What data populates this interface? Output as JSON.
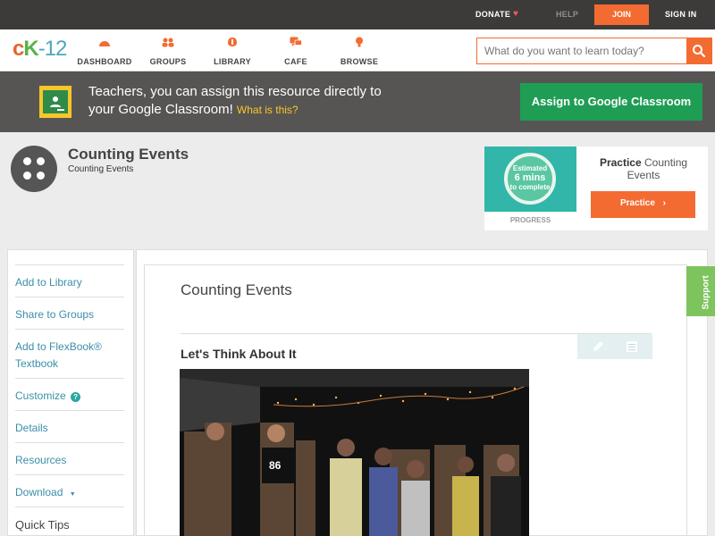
{
  "topbar": {
    "donate": "DONATE",
    "help": "HELP",
    "join": "JOIN",
    "signin": "SIGN IN"
  },
  "nav": {
    "logo": {
      "c": "c",
      "k": "K",
      "n": "-12"
    },
    "items": [
      {
        "label": "DASHBOARD",
        "icon": "dashboard-icon"
      },
      {
        "label": "GROUPS",
        "icon": "groups-icon"
      },
      {
        "label": "LIBRARY",
        "icon": "library-icon"
      },
      {
        "label": "CAFE",
        "icon": "cafe-icon"
      },
      {
        "label": "BROWSE",
        "icon": "browse-icon"
      }
    ],
    "search_placeholder": "What do you want to learn today?"
  },
  "banner": {
    "text_line1": "Teachers, you can assign this resource directly to",
    "text_line2": "your Google Classroom!",
    "what_link": "What is this?",
    "button": "Assign to Google Classroom"
  },
  "page": {
    "title": "Counting Events",
    "subtitle": "Counting Events"
  },
  "practice": {
    "estimated": "Estimated",
    "mins": "6 mins",
    "to_complete": "to complete",
    "progress": "PROGRESS",
    "label_bold": "Practice",
    "label_rest": "Counting Events",
    "button": "Practice"
  },
  "sidebar": {
    "items": [
      {
        "label": "Add to Library"
      },
      {
        "label": "Share to Groups"
      },
      {
        "label": "Add to FlexBook®"
      },
      {
        "label": "Textbook"
      },
      {
        "label": "Customize"
      },
      {
        "label": "Details"
      },
      {
        "label": "Resources"
      },
      {
        "label": "Download"
      },
      {
        "label": "Quick Tips"
      }
    ],
    "help_glyph": "?",
    "download_caret": "▼"
  },
  "content": {
    "title": "Counting Events",
    "heading": "Let's Think About It"
  },
  "support": "Support",
  "colors": {
    "accent": "#f36b31",
    "green": "#1f9d55",
    "teal": "#3a8fa8",
    "banner": "#575553"
  }
}
